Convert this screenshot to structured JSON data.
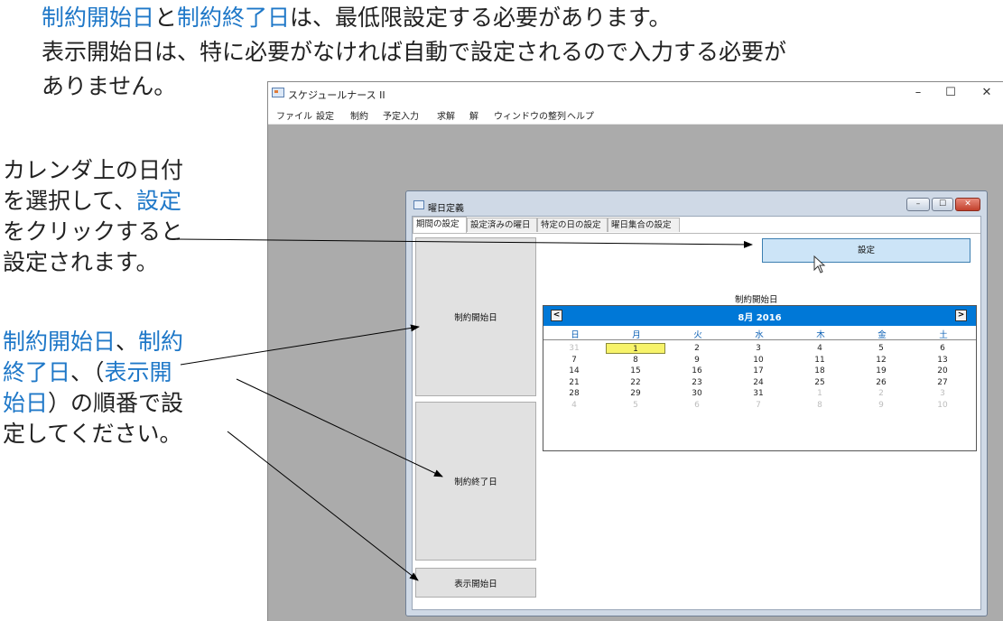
{
  "notes": {
    "top_line1": [
      {
        "text": "制約開始日",
        "hl": true
      },
      {
        "text": "と",
        "hl": false
      },
      {
        "text": "制約終了日",
        "hl": true
      },
      {
        "text": "は、最低限設定する必要があります。",
        "hl": false
      }
    ],
    "top_line2": [
      {
        "text": "表示開始日は、特に必要がなければ自動で設定されるので入力する必要が",
        "hl": false
      }
    ],
    "top_line3": [
      {
        "text": "ありません。",
        "hl": false
      }
    ],
    "side1": [
      [
        {
          "text": "カレンダ上の日付",
          "hl": false
        }
      ],
      [
        {
          "text": "を選択して、",
          "hl": false
        },
        {
          "text": "設定",
          "hl": true
        }
      ],
      [
        {
          "text": "をクリックすると",
          "hl": false
        }
      ],
      [
        {
          "text": "設定されます。",
          "hl": false
        }
      ]
    ],
    "side2": [
      [
        {
          "text": "制約開始日",
          "hl": true
        },
        {
          "text": "、",
          "hl": false
        },
        {
          "text": "制約",
          "hl": true
        }
      ],
      [
        {
          "text": "終了日",
          "hl": true
        },
        {
          "text": "、（",
          "hl": false
        },
        {
          "text": "表示開",
          "hl": true
        }
      ],
      [
        {
          "text": "始日",
          "hl": true
        },
        {
          "text": "）の順番で設",
          "hl": false
        }
      ],
      [
        {
          "text": "定してください。",
          "hl": false
        }
      ]
    ]
  },
  "app": {
    "title": "スケジュールナース II",
    "controls": {
      "minimize": "–",
      "maximize": "☐",
      "close": "✕"
    },
    "menu": [
      "ファイル",
      "設定",
      "制約",
      "予定入力",
      "求解",
      "解",
      "ウィンドウの整列",
      "ヘルプ"
    ]
  },
  "dialog": {
    "title": "曜日定義",
    "tabs": [
      "期間の設定",
      "設定済みの曜日",
      "特定の日の設定",
      "曜日集合の設定"
    ],
    "active_tab": 0,
    "left_buttons": [
      "制約開始日",
      "制約終了日",
      "表示開始日"
    ],
    "set_button": "設定",
    "calendar_caption": "制約開始日",
    "calendar": {
      "month_label": "8月 2016",
      "prev": "<",
      "next": ">",
      "weekdays": [
        "日",
        "月",
        "火",
        "水",
        "木",
        "金",
        "土"
      ],
      "weeks": [
        [
          "31",
          "1",
          "2",
          "3",
          "4",
          "5",
          "6"
        ],
        [
          "7",
          "8",
          "9",
          "10",
          "11",
          "12",
          "13"
        ],
        [
          "14",
          "15",
          "16",
          "17",
          "18",
          "19",
          "20"
        ],
        [
          "21",
          "22",
          "23",
          "24",
          "25",
          "26",
          "27"
        ],
        [
          "28",
          "29",
          "30",
          "31",
          "1",
          "2",
          "3"
        ],
        [
          "4",
          "5",
          "6",
          "7",
          "8",
          "9",
          "10"
        ]
      ],
      "selected": "2016-08-01"
    }
  },
  "colors": {
    "highlight": "#1f78c8",
    "calendar_header": "#0078d7",
    "selected_day": "#f7f36a",
    "set_button": "#cce4f7"
  }
}
